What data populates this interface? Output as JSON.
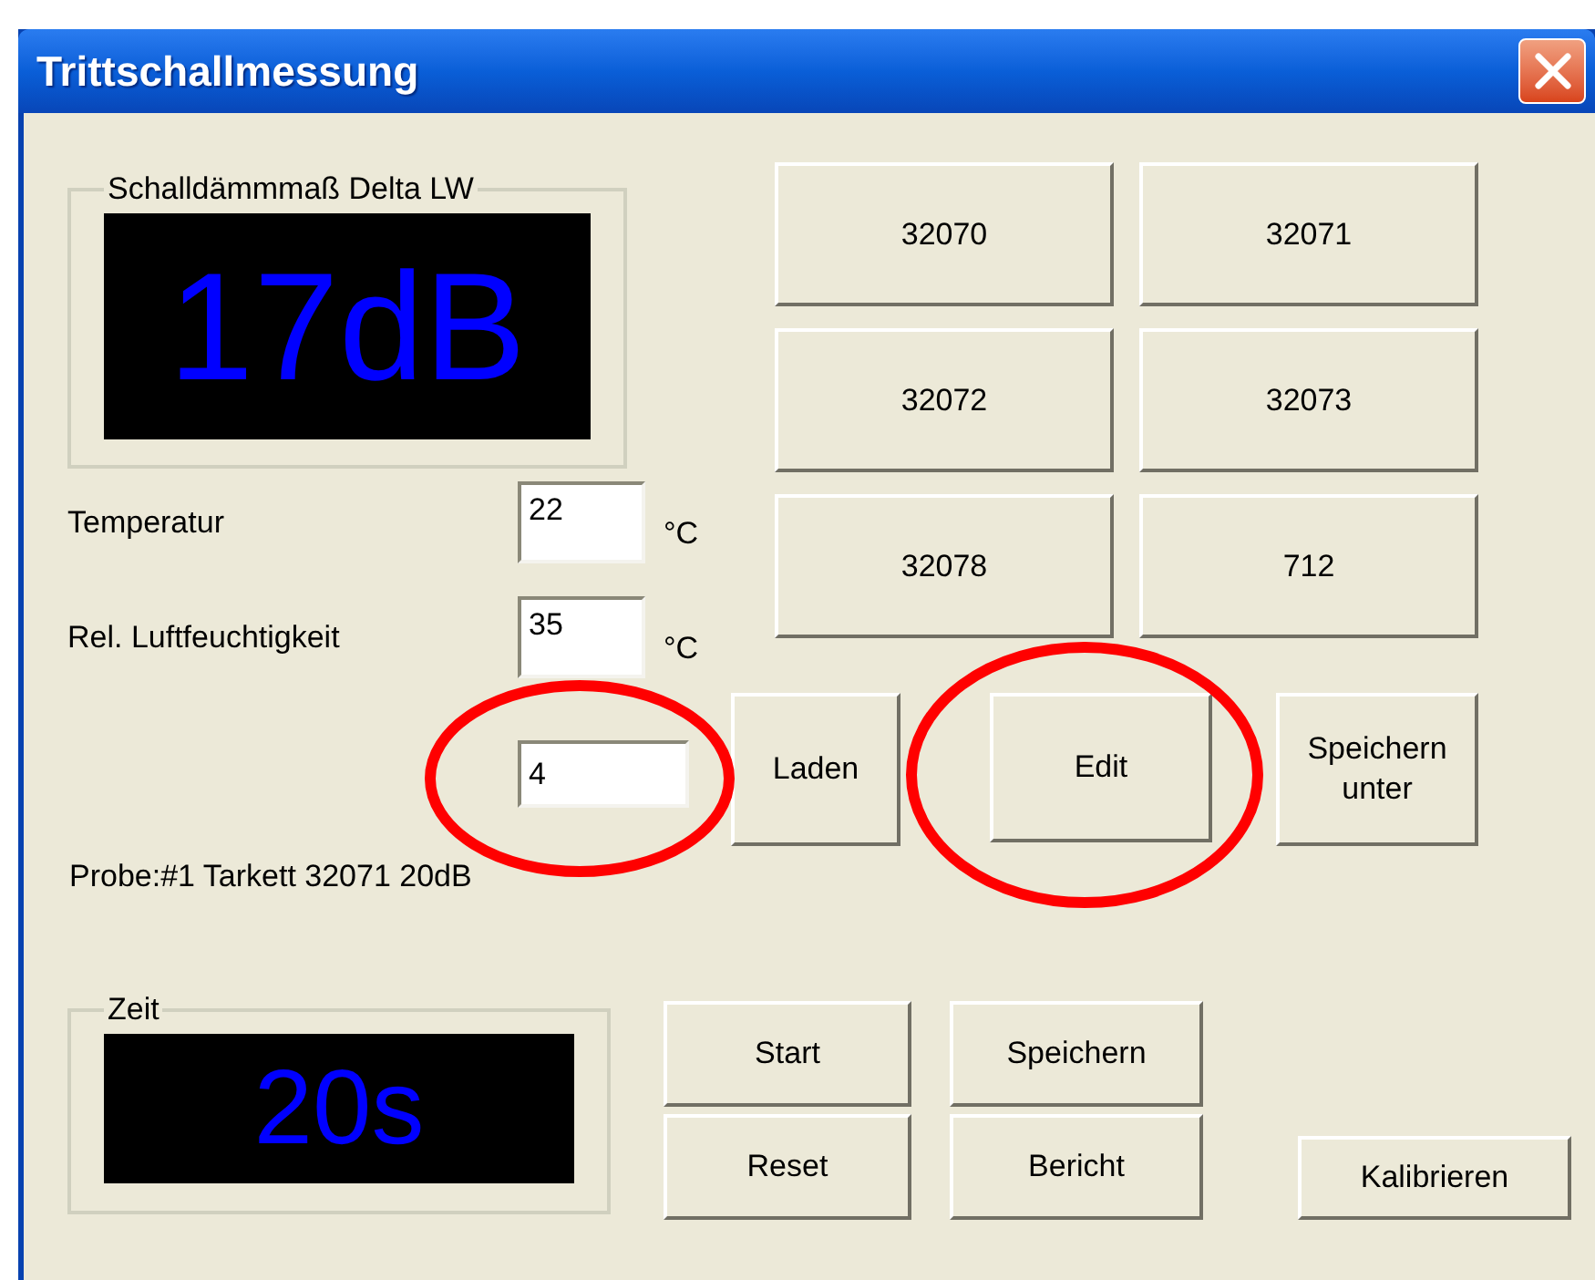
{
  "window": {
    "title": "Trittschallmessung"
  },
  "sound_display": {
    "label": "Schalldämmmaß Delta LW",
    "value": "17dB"
  },
  "sample_buttons": [
    "32070",
    "32071",
    "32072",
    "32073",
    "32078",
    "712"
  ],
  "fields": [
    {
      "label": "Temperatur",
      "value": "22",
      "unit": "°C"
    },
    {
      "label": "Rel. Luftfeuchtigkeit",
      "value": "35",
      "unit": "°C"
    },
    {
      "value": "4"
    }
  ],
  "action_buttons": [
    "Laden",
    "Edit",
    "Speichern unter"
  ],
  "sample_info": "Probe:#1 Tarkett 32071 20dB",
  "time_display": {
    "label": "Zeit",
    "value": "20s"
  },
  "control_buttons": [
    "Start",
    "Reset",
    "Speichern",
    "Bericht"
  ],
  "calibrate_button": "Kalibrieren"
}
